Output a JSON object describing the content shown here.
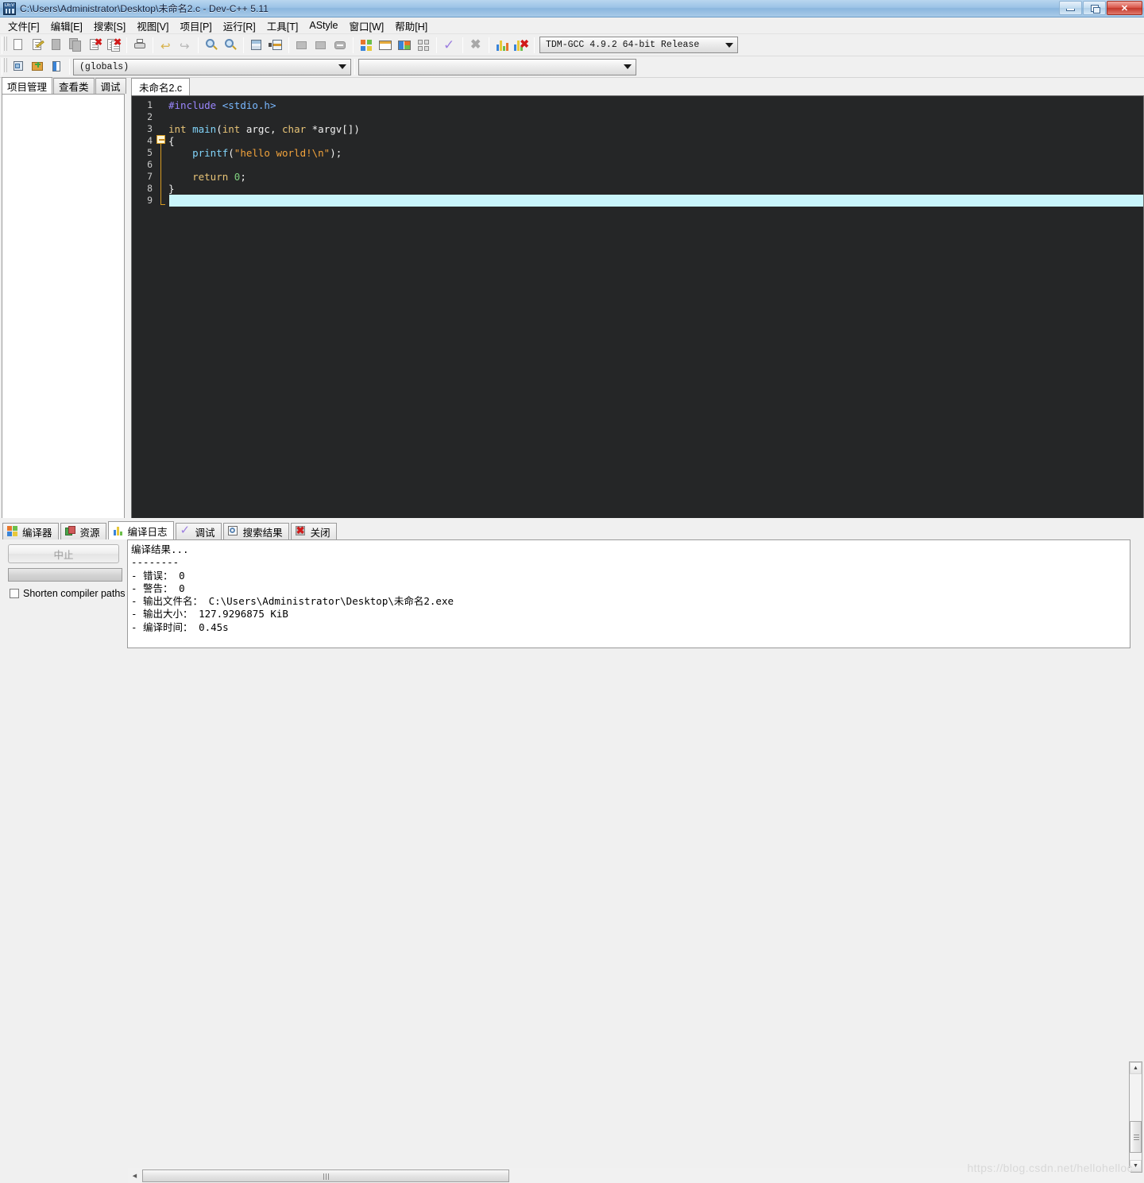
{
  "window": {
    "title": "C:\\Users\\Administrator\\Desktop\\未命名2.c - Dev-C++ 5.11",
    "icon": "devcpp-app-icon",
    "minimize_label": "",
    "maximize_label": "",
    "close_label": "✕"
  },
  "menubar": {
    "items": [
      {
        "label": "文件[F]",
        "name": "menu-file"
      },
      {
        "label": "编辑[E]",
        "name": "menu-edit"
      },
      {
        "label": "搜索[S]",
        "name": "menu-search"
      },
      {
        "label": "视图[V]",
        "name": "menu-view"
      },
      {
        "label": "项目[P]",
        "name": "menu-project"
      },
      {
        "label": "运行[R]",
        "name": "menu-run"
      },
      {
        "label": "工具[T]",
        "name": "menu-tools"
      },
      {
        "label": "AStyle",
        "name": "menu-astyle"
      },
      {
        "label": "窗口[W]",
        "name": "menu-window"
      },
      {
        "label": "帮助[H]",
        "name": "menu-help"
      }
    ]
  },
  "toolbar1": {
    "buttons": [
      {
        "name": "new-file-icon",
        "title": "新建"
      },
      {
        "name": "open-file-icon",
        "title": "打开"
      },
      {
        "name": "save-file-icon",
        "title": "保存"
      },
      {
        "name": "save-all-icon",
        "title": "全部保存"
      },
      {
        "name": "close-file-icon",
        "title": "关闭"
      },
      {
        "name": "close-all-icon",
        "title": "全部关闭"
      },
      {
        "name": "print-icon",
        "title": "打印"
      },
      {
        "name": "undo-icon",
        "title": "撤销"
      },
      {
        "name": "redo-icon",
        "title": "重做"
      },
      {
        "name": "find-icon",
        "title": "查找"
      },
      {
        "name": "replace-icon",
        "title": "替换"
      },
      {
        "name": "goto-line-icon",
        "title": "转到行"
      },
      {
        "name": "goto-function-icon",
        "title": "转到函数"
      },
      {
        "name": "back-icon",
        "title": "后退"
      },
      {
        "name": "forward-icon",
        "title": "前进"
      },
      {
        "name": "toggle-breakpoint-icon",
        "title": "断点"
      },
      {
        "name": "compile-icon",
        "title": "编译"
      },
      {
        "name": "run-icon",
        "title": "运行"
      },
      {
        "name": "compile-run-icon",
        "title": "编译运行"
      },
      {
        "name": "rebuild-icon",
        "title": "全部重新编译"
      },
      {
        "name": "syntax-check-icon",
        "title": "语法检查"
      },
      {
        "name": "stop-execution-icon",
        "title": "停止执行"
      },
      {
        "name": "profile-icon",
        "title": "性能分析"
      },
      {
        "name": "delete-profile-icon",
        "title": "删除分析信息"
      }
    ],
    "compiler_select": {
      "value": "TDM-GCC 4.9.2 64-bit Release",
      "name": "compiler-set-select"
    }
  },
  "toolbar2": {
    "buttons": [
      {
        "name": "new-project-icon",
        "title": "新建项目"
      },
      {
        "name": "add-to-project-icon",
        "title": "添加到项目"
      },
      {
        "name": "project-options-icon",
        "title": "项目属性"
      }
    ],
    "scope_select": {
      "value": "(globals)",
      "name": "scope-select"
    },
    "member_select": {
      "value": "",
      "name": "member-select"
    }
  },
  "left_panel": {
    "tabs": [
      {
        "label": "项目管理",
        "name": "tab-project-manager",
        "active": true
      },
      {
        "label": "查看类",
        "name": "tab-class-browser",
        "active": false
      },
      {
        "label": "调试",
        "name": "tab-debug-browser",
        "active": false
      }
    ]
  },
  "editor": {
    "tabs": [
      {
        "label": "未命名2.c",
        "name": "editor-tab-untitled2",
        "active": true
      }
    ],
    "gutter_numbers": [
      "1",
      "2",
      "3",
      "4",
      "5",
      "6",
      "7",
      "8",
      "9"
    ],
    "current_line": 9,
    "code_lines": [
      {
        "n": "1",
        "tokens": [
          {
            "t": "#include",
            "c": "pre"
          },
          {
            "t": " ",
            "c": "pn"
          },
          {
            "t": "<stdio.h>",
            "c": "hdr"
          }
        ]
      },
      {
        "n": "2",
        "tokens": []
      },
      {
        "n": "3",
        "tokens": [
          {
            "t": "int",
            "c": "kw"
          },
          {
            "t": " ",
            "c": "pn"
          },
          {
            "t": "main",
            "c": "fn"
          },
          {
            "t": "(",
            "c": "pn"
          },
          {
            "t": "int",
            "c": "kw"
          },
          {
            "t": " argc, ",
            "c": "pn"
          },
          {
            "t": "char",
            "c": "kw"
          },
          {
            "t": " *argv[])",
            "c": "pn"
          }
        ]
      },
      {
        "n": "4",
        "tokens": [
          {
            "t": "{",
            "c": "pn"
          }
        ]
      },
      {
        "n": "5",
        "tokens": [
          {
            "t": "    ",
            "c": "pn"
          },
          {
            "t": "printf",
            "c": "fn"
          },
          {
            "t": "(",
            "c": "pn"
          },
          {
            "t": "\"hello world!\\n\"",
            "c": "str"
          },
          {
            "t": ");",
            "c": "pn"
          }
        ]
      },
      {
        "n": "6",
        "tokens": []
      },
      {
        "n": "7",
        "tokens": [
          {
            "t": "    ",
            "c": "pn"
          },
          {
            "t": "return",
            "c": "kw"
          },
          {
            "t": " ",
            "c": "pn"
          },
          {
            "t": "0",
            "c": "num"
          },
          {
            "t": ";",
            "c": "pn"
          }
        ]
      },
      {
        "n": "8",
        "tokens": [
          {
            "t": "}",
            "c": "pn"
          }
        ]
      },
      {
        "n": "9",
        "tokens": []
      }
    ]
  },
  "bottom_panel": {
    "tabs": [
      {
        "label": "编译器",
        "name": "tab-compiler",
        "icon": "compiler-grid-icon",
        "active": false
      },
      {
        "label": "资源",
        "name": "tab-resources",
        "icon": "resources-icon",
        "active": false
      },
      {
        "label": "编译日志",
        "name": "tab-compile-log",
        "icon": "compile-log-chart-icon",
        "active": true
      },
      {
        "label": "调试",
        "name": "tab-debug",
        "icon": "debug-check-icon",
        "active": false
      },
      {
        "label": "搜索结果",
        "name": "tab-search-results",
        "icon": "search-results-icon",
        "active": false
      },
      {
        "label": "关闭",
        "name": "tab-close-panel",
        "icon": "close-red-icon",
        "active": false
      }
    ],
    "abort_button": {
      "label": "中止",
      "name": "abort-button",
      "enabled": false
    },
    "progress_value": 0,
    "shorten_paths": {
      "label": "Shorten compiler paths",
      "checked": false,
      "name": "shorten-compiler-paths-checkbox"
    },
    "log_lines": [
      "编译结果...",
      "--------",
      "- 错误： 0",
      "- 警告： 0",
      "- 输出文件名： C:\\Users\\Administrator\\Desktop\\未命名2.exe",
      "- 输出大小： 127.9296875 KiB",
      "- 编译时间： 0.45s"
    ]
  },
  "scrollbars": {
    "vertical_up": "▲",
    "vertical_down": "▼",
    "horizontal_left": "◀",
    "horizontal_right": "▶"
  },
  "watermark": "https://blog.csdn.net/hellohelloc",
  "colors": {
    "titlebar_start": "#b9d6ef",
    "titlebar_end": "#8ab6de",
    "close_button": "#c3382b",
    "editor_bg": "#252627",
    "current_line": "#c9f5fb",
    "keyword": "#e8c477",
    "preprocessor": "#9a86fd",
    "header": "#79b8ff",
    "function": "#81d4fa",
    "string": "#f2a33c",
    "number": "#7fd17f",
    "fold_marker": "#d79b22"
  }
}
